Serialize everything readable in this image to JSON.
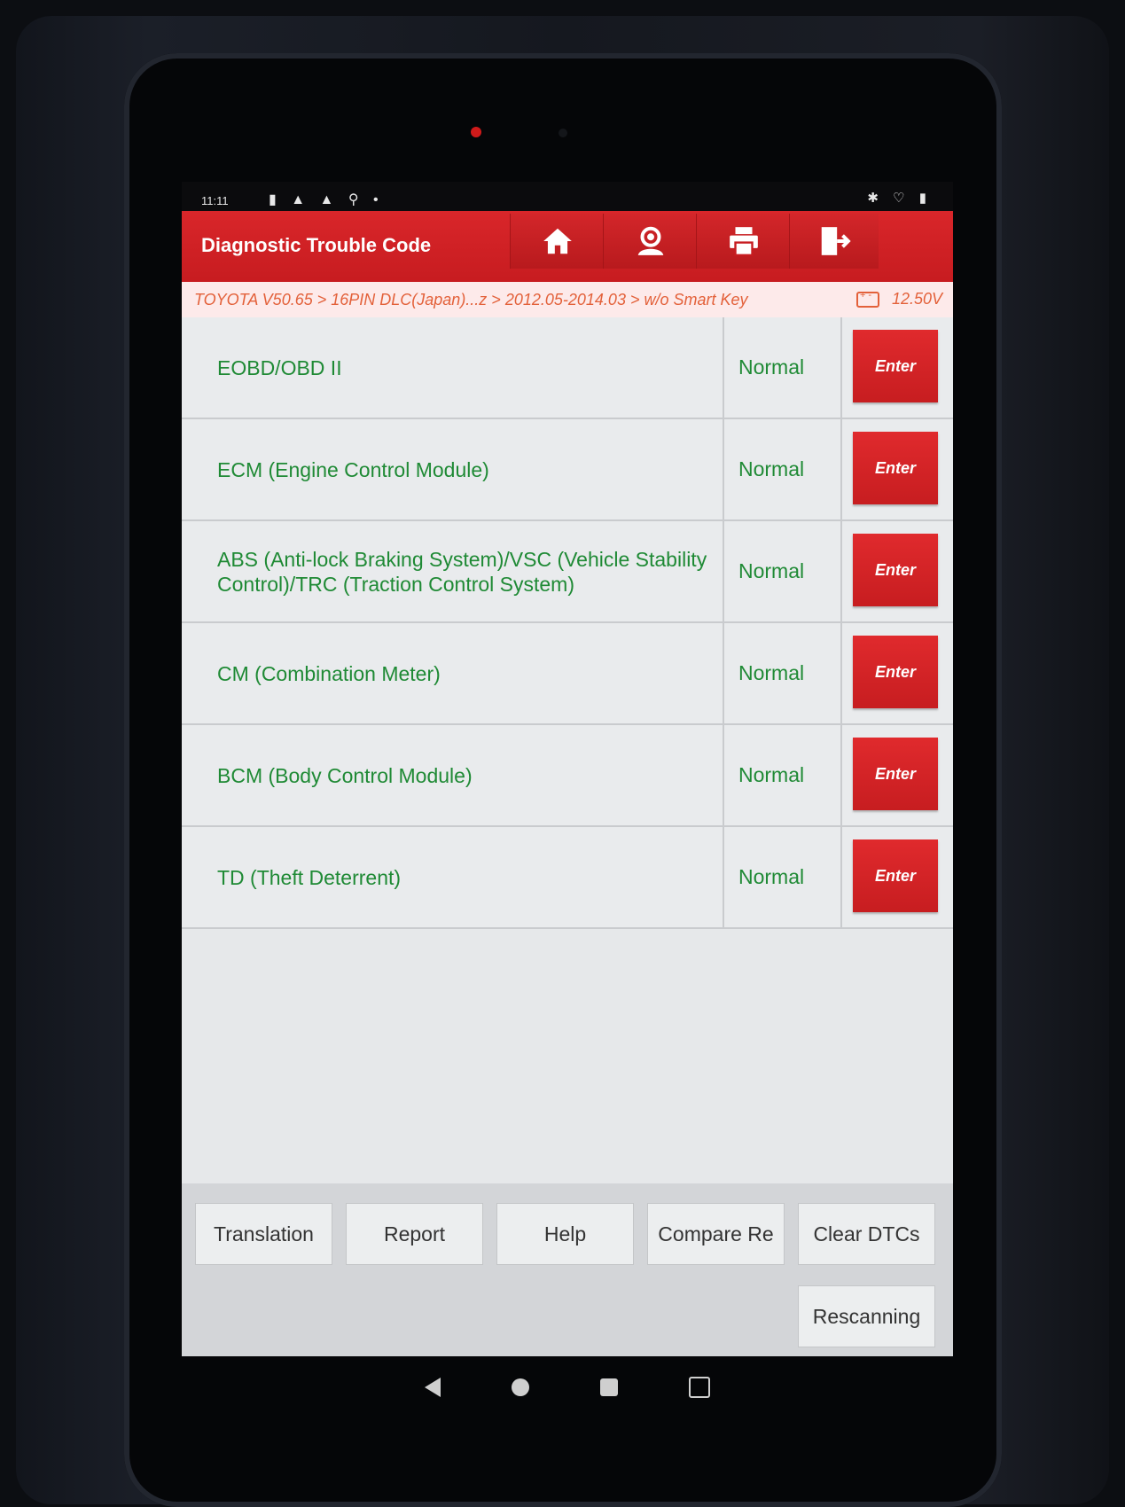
{
  "status_bar": {
    "time": "11:11 ",
    "left_icons": "▮ ▲ ▲ ⚲ •",
    "right_icons": "✱ ♡ ▮"
  },
  "header": {
    "title": "Diagnostic Trouble Code",
    "buttons": [
      "home-icon",
      "user-icon",
      "print-icon",
      "exit-icon"
    ]
  },
  "breadcrumb": {
    "path": "TOYOTA V50.65 > 16PIN DLC(Japan)...z > 2012.05-2014.03 > w/o Smart Key",
    "voltage": "12.50V"
  },
  "systems": [
    {
      "name": "EOBD/OBD II",
      "status": "Normal",
      "action": "Enter"
    },
    {
      "name": "ECM (Engine Control Module)",
      "status": "Normal",
      "action": "Enter"
    },
    {
      "name": "ABS (Anti-lock Braking System)/VSC (Vehicle Stability Control)/TRC (Traction Control System)",
      "status": "Normal",
      "action": "Enter"
    },
    {
      "name": "CM (Combination Meter)",
      "status": "Normal",
      "action": "Enter"
    },
    {
      "name": "BCM (Body Control Module)",
      "status": "Normal",
      "action": "Enter"
    },
    {
      "name": "TD (Theft Deterrent)",
      "status": "Normal",
      "action": "Enter"
    }
  ],
  "footer": {
    "translation": "Translation",
    "report": "Report",
    "help": "Help",
    "compare": "Compare Re",
    "clear_dtcs": "Clear DTCs",
    "rescanning": "Rescanning"
  },
  "colors": {
    "brand_red": "#d9262a",
    "text_green": "#1f8a35",
    "breadcrumb_orange": "#e3613a"
  }
}
